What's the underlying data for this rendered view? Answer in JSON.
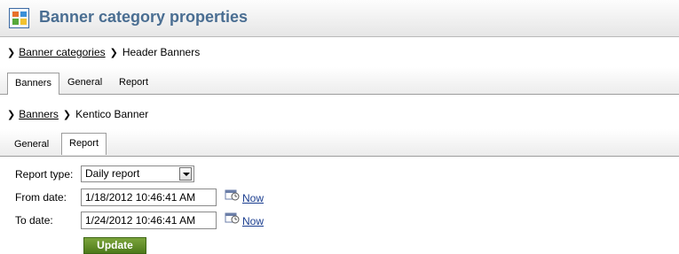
{
  "window": {
    "title": "Banner category properties"
  },
  "breadcrumb1": {
    "link": "Banner categories",
    "current": "Header Banners"
  },
  "tabs1": [
    {
      "label": "Banners",
      "active": true
    },
    {
      "label": "General",
      "active": false
    },
    {
      "label": "Report",
      "active": false
    }
  ],
  "breadcrumb2": {
    "link": "Banners",
    "current": "Kentico Banner"
  },
  "tabs2": [
    {
      "label": "General",
      "active": false
    },
    {
      "label": "Report",
      "active": true
    }
  ],
  "form": {
    "report_type_label": "Report type:",
    "report_type_value": "Daily report",
    "from_label": "From date:",
    "from_value": "1/18/2012 10:46:41 AM",
    "to_label": "To date:",
    "to_value": "1/24/2012 10:46:41 AM",
    "now_label": "Now",
    "update_label": "Update"
  },
  "colors": {
    "title": "#4a6e92",
    "button": "#5b8a24",
    "link": "#1a3d8f"
  }
}
